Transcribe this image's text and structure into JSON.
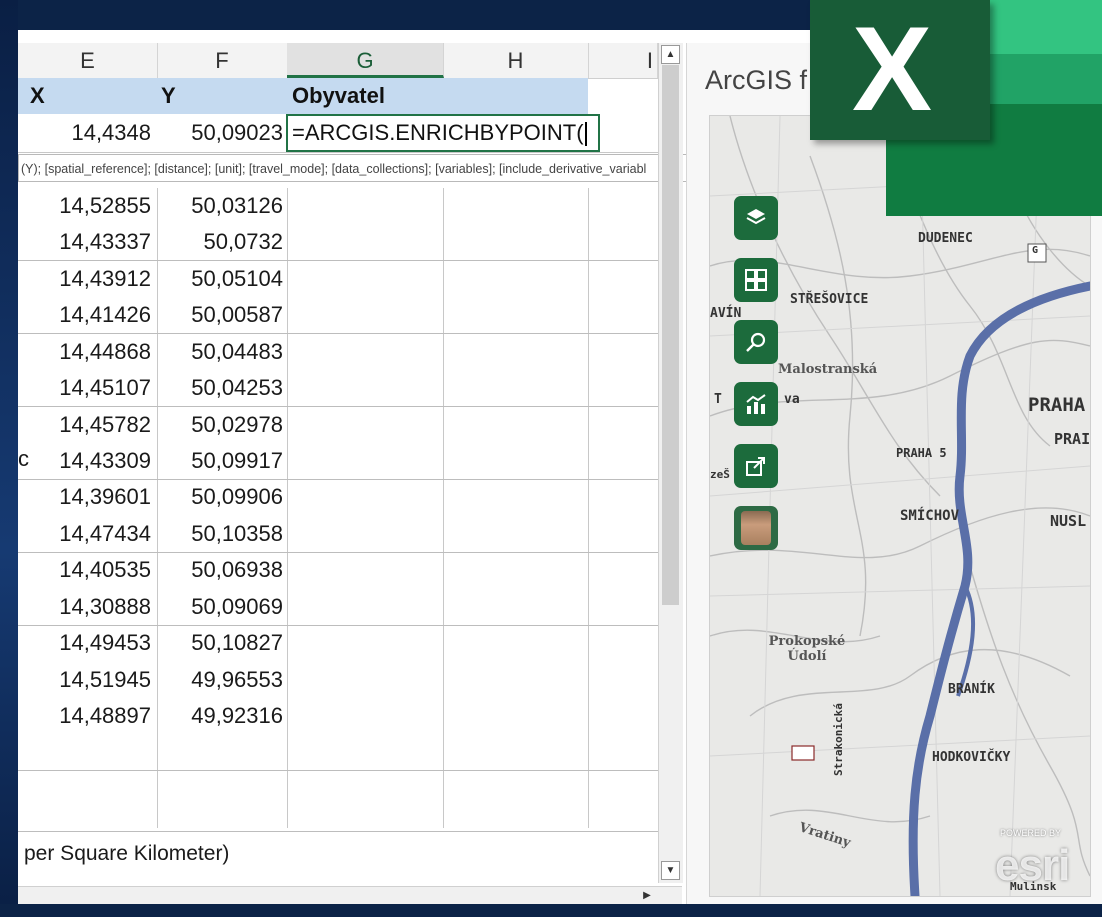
{
  "spreadsheet": {
    "column_headers": [
      "E",
      "F",
      "G",
      "H",
      "I"
    ],
    "selected_column": "G",
    "header_row": {
      "x": "X",
      "y": "Y",
      "obyvatel": "Obyvatel"
    },
    "formula_row": {
      "x": "14,4348",
      "y": "50,09023",
      "formula": "=ARCGIS.ENRICHBYPOINT("
    },
    "function_tooltip": "(Y); [spatial_reference]; [distance]; [unit]; [travel_mode]; [data_collections]; [variables]; [include_derivative_variabl",
    "rows": [
      {
        "x": "14,52855",
        "y": "50,03126"
      },
      {
        "x": "14,43337",
        "y": "50,0732"
      },
      {
        "x": "14,43912",
        "y": "50,05104"
      },
      {
        "x": "14,41426",
        "y": "50,00587"
      },
      {
        "x": "14,44868",
        "y": "50,04483"
      },
      {
        "x": "14,45107",
        "y": "50,04253"
      },
      {
        "x": "14,45782",
        "y": "50,02978"
      },
      {
        "x": "14,43309",
        "y": "50,09917"
      },
      {
        "x": "14,39601",
        "y": "50,09906"
      },
      {
        "x": "14,47434",
        "y": "50,10358"
      },
      {
        "x": "14,40535",
        "y": "50,06938"
      },
      {
        "x": "14,30888",
        "y": "50,09069"
      },
      {
        "x": "14,49453",
        "y": "50,10827"
      },
      {
        "x": "14,51945",
        "y": "49,96553"
      },
      {
        "x": "14,48897",
        "y": "49,92316"
      }
    ],
    "left_fragment": "c",
    "footnote": "per Square Kilometer)"
  },
  "arcgis_pane": {
    "title": "ArcGIS f",
    "toolbar": [
      {
        "icon": "layers-icon"
      },
      {
        "icon": "grid-icon"
      },
      {
        "icon": "search-icon"
      },
      {
        "icon": "analysis-icon"
      },
      {
        "icon": "share-icon"
      },
      {
        "icon": "user-avatar"
      }
    ],
    "map_labels": {
      "dudenec": "DUDENEC",
      "g": "G",
      "stresovice": "STŘEŠOVICE",
      "avin": "AVÍN",
      "malostranska": "Malostranská",
      "praha": "PRAHA",
      "pral": "PRAI",
      "praha5": "PRAHA 5",
      "smichov": "SMÍCHOV",
      "nusl": "NUSL",
      "prokopske": "Prokopské Údolí",
      "branik": "BRANÍK",
      "hodkovicky": "HODKOVIČKY",
      "strakonicka": "Strakonická",
      "vratiny": "Vratiny",
      "zet": "zeŠ",
      "t": "T",
      "va": "va",
      "mulinsky": "Mulinsk"
    },
    "watermark": "esri",
    "watermark_small": "POWERED BY"
  },
  "logo": {
    "letter": "X",
    "colors": {
      "dark": "#185c37",
      "mid": "#107c41",
      "light": "#33c481",
      "accent": "#21a366"
    }
  },
  "colors": {
    "excel_green": "#217346",
    "header_blue": "#c5daf0",
    "river": "#5a6fa8"
  }
}
